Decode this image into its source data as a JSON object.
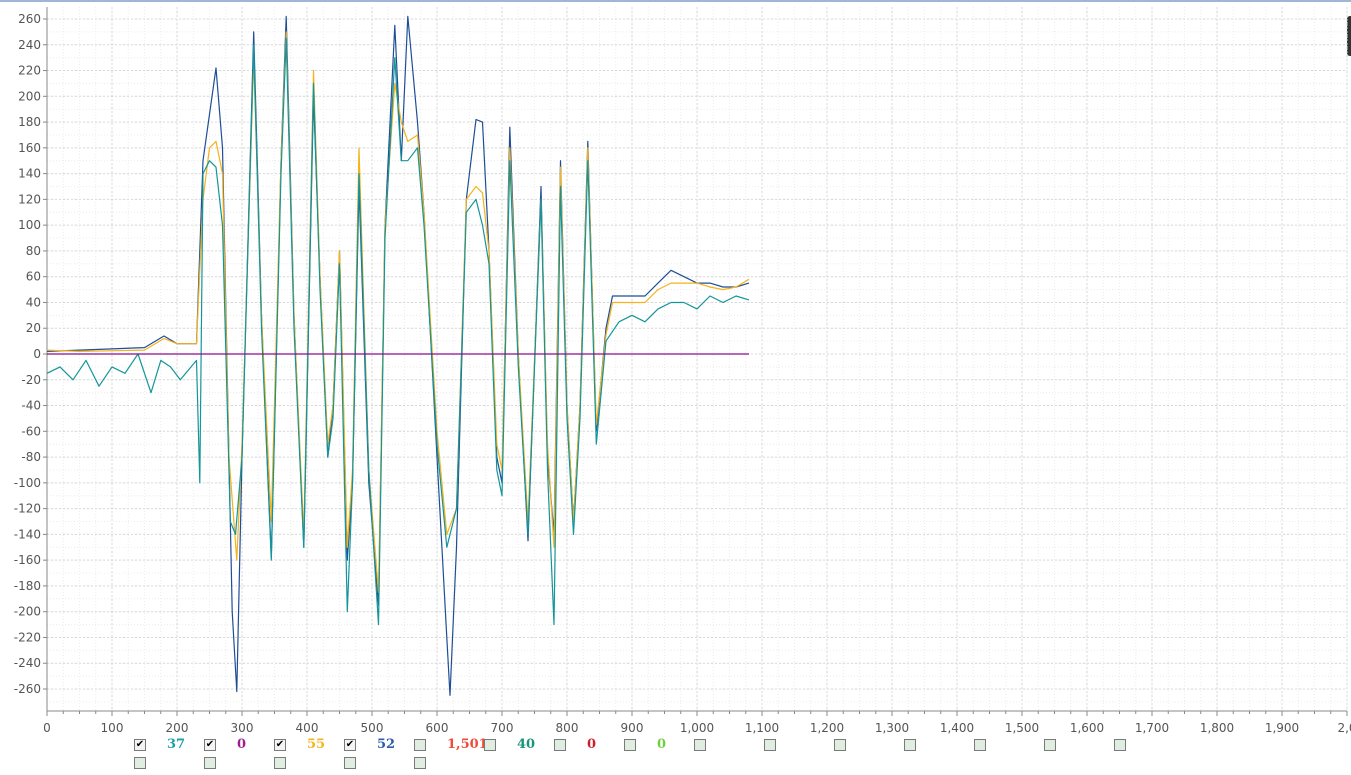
{
  "chart_data": {
    "type": "line",
    "xlim": [
      0,
      2000
    ],
    "ylim": [
      -270,
      265
    ],
    "x_ticks": [
      0,
      100,
      200,
      300,
      400,
      500,
      600,
      700,
      800,
      900,
      1000,
      1100,
      1200,
      1300,
      1400,
      1500,
      1600,
      1700,
      1800,
      1900,
      2000
    ],
    "x_tick_labels": [
      "0",
      "100",
      "200",
      "300",
      "400",
      "500",
      "600",
      "700",
      "800",
      "900",
      "1,000",
      "1,100",
      "1,200",
      "1,300",
      "1,400",
      "1,500",
      "1,600",
      "1,700",
      "1,800",
      "1,900",
      "2,0"
    ],
    "y_ticks": [
      260,
      240,
      220,
      200,
      180,
      160,
      140,
      120,
      100,
      80,
      60,
      40,
      20,
      0,
      -20,
      -40,
      -60,
      -80,
      -100,
      -120,
      -140,
      -160,
      -180,
      -200,
      -220,
      -240,
      -260
    ],
    "y_tick_labels": [
      "260",
      "240",
      "220",
      "200",
      "180",
      "160",
      "140",
      "120",
      "100",
      "80",
      "60",
      "40",
      "20",
      "0",
      "-20",
      "-40",
      "-60",
      "-80",
      "-100",
      "-120",
      "-140",
      "-160",
      "-180",
      "-200",
      "-220",
      "-240",
      "-260"
    ],
    "grid": true,
    "series": [
      {
        "color": "#1f4e96",
        "points": [
          [
            0,
            2
          ],
          [
            50,
            3
          ],
          [
            150,
            5
          ],
          [
            180,
            14
          ],
          [
            200,
            8
          ],
          [
            230,
            8
          ],
          [
            240,
            150
          ],
          [
            260,
            222
          ],
          [
            270,
            160
          ],
          [
            285,
            -200
          ],
          [
            292,
            -262
          ],
          [
            300,
            -80
          ],
          [
            318,
            250
          ],
          [
            330,
            30
          ],
          [
            345,
            -158
          ],
          [
            360,
            150
          ],
          [
            368,
            262
          ],
          [
            380,
            30
          ],
          [
            395,
            -150
          ],
          [
            410,
            200
          ],
          [
            420,
            60
          ],
          [
            432,
            -80
          ],
          [
            440,
            -40
          ],
          [
            450,
            80
          ],
          [
            462,
            -160
          ],
          [
            470,
            -100
          ],
          [
            480,
            130
          ],
          [
            495,
            -100
          ],
          [
            510,
            -195
          ],
          [
            520,
            100
          ],
          [
            535,
            255
          ],
          [
            545,
            150
          ],
          [
            555,
            262
          ],
          [
            570,
            180
          ],
          [
            580,
            110
          ],
          [
            600,
            -80
          ],
          [
            615,
            -220
          ],
          [
            620,
            -265
          ],
          [
            630,
            -150
          ],
          [
            645,
            120
          ],
          [
            660,
            182
          ],
          [
            670,
            180
          ],
          [
            680,
            80
          ],
          [
            692,
            -80
          ],
          [
            700,
            -100
          ],
          [
            712,
            176
          ],
          [
            725,
            0
          ],
          [
            740,
            -145
          ],
          [
            760,
            130
          ],
          [
            770,
            -80
          ],
          [
            780,
            -140
          ],
          [
            790,
            150
          ],
          [
            800,
            -40
          ],
          [
            810,
            -130
          ],
          [
            820,
            -40
          ],
          [
            832,
            165
          ],
          [
            845,
            -60
          ],
          [
            860,
            20
          ],
          [
            870,
            45
          ],
          [
            890,
            45
          ],
          [
            920,
            45
          ],
          [
            940,
            55
          ],
          [
            960,
            65
          ],
          [
            980,
            60
          ],
          [
            1000,
            55
          ],
          [
            1020,
            55
          ],
          [
            1040,
            52
          ],
          [
            1060,
            52
          ],
          [
            1080,
            55
          ]
        ]
      },
      {
        "color": "#f5b21a",
        "points": [
          [
            0,
            3
          ],
          [
            50,
            2
          ],
          [
            150,
            3
          ],
          [
            180,
            12
          ],
          [
            200,
            8
          ],
          [
            230,
            8
          ],
          [
            240,
            120
          ],
          [
            250,
            160
          ],
          [
            260,
            165
          ],
          [
            270,
            140
          ],
          [
            280,
            -80
          ],
          [
            292,
            -160
          ],
          [
            300,
            -70
          ],
          [
            318,
            230
          ],
          [
            330,
            30
          ],
          [
            345,
            -130
          ],
          [
            360,
            150
          ],
          [
            368,
            250
          ],
          [
            380,
            30
          ],
          [
            395,
            -140
          ],
          [
            410,
            220
          ],
          [
            420,
            60
          ],
          [
            432,
            -70
          ],
          [
            440,
            -40
          ],
          [
            450,
            80
          ],
          [
            462,
            -150
          ],
          [
            470,
            -90
          ],
          [
            480,
            160
          ],
          [
            495,
            -90
          ],
          [
            510,
            -185
          ],
          [
            520,
            100
          ],
          [
            535,
            210
          ],
          [
            545,
            180
          ],
          [
            555,
            165
          ],
          [
            570,
            170
          ],
          [
            580,
            110
          ],
          [
            600,
            -60
          ],
          [
            615,
            -140
          ],
          [
            630,
            -120
          ],
          [
            645,
            120
          ],
          [
            660,
            130
          ],
          [
            670,
            125
          ],
          [
            680,
            80
          ],
          [
            692,
            -70
          ],
          [
            700,
            -90
          ],
          [
            712,
            160
          ],
          [
            725,
            0
          ],
          [
            740,
            -130
          ],
          [
            760,
            120
          ],
          [
            770,
            -70
          ],
          [
            780,
            -150
          ],
          [
            790,
            145
          ],
          [
            800,
            -40
          ],
          [
            810,
            -130
          ],
          [
            820,
            -40
          ],
          [
            832,
            160
          ],
          [
            845,
            -55
          ],
          [
            860,
            15
          ],
          [
            870,
            40
          ],
          [
            890,
            40
          ],
          [
            920,
            40
          ],
          [
            940,
            50
          ],
          [
            960,
            55
          ],
          [
            980,
            55
          ],
          [
            1000,
            55
          ],
          [
            1020,
            52
          ],
          [
            1040,
            50
          ],
          [
            1060,
            52
          ],
          [
            1080,
            58
          ]
        ]
      },
      {
        "color": "#13959a",
        "points": [
          [
            0,
            -15
          ],
          [
            20,
            -10
          ],
          [
            40,
            -20
          ],
          [
            60,
            -5
          ],
          [
            80,
            -25
          ],
          [
            100,
            -10
          ],
          [
            120,
            -15
          ],
          [
            140,
            0
          ],
          [
            160,
            -30
          ],
          [
            175,
            -5
          ],
          [
            190,
            -10
          ],
          [
            205,
            -20
          ],
          [
            230,
            -5
          ],
          [
            235,
            -100
          ],
          [
            240,
            140
          ],
          [
            250,
            150
          ],
          [
            260,
            145
          ],
          [
            270,
            100
          ],
          [
            282,
            -130
          ],
          [
            290,
            -140
          ],
          [
            300,
            -80
          ],
          [
            318,
            240
          ],
          [
            330,
            20
          ],
          [
            345,
            -160
          ],
          [
            360,
            140
          ],
          [
            368,
            245
          ],
          [
            380,
            20
          ],
          [
            395,
            -150
          ],
          [
            410,
            210
          ],
          [
            420,
            50
          ],
          [
            432,
            -80
          ],
          [
            440,
            -50
          ],
          [
            450,
            70
          ],
          [
            462,
            -200
          ],
          [
            470,
            -100
          ],
          [
            480,
            140
          ],
          [
            495,
            -90
          ],
          [
            510,
            -210
          ],
          [
            520,
            90
          ],
          [
            535,
            230
          ],
          [
            545,
            150
          ],
          [
            555,
            150
          ],
          [
            570,
            160
          ],
          [
            580,
            100
          ],
          [
            600,
            -70
          ],
          [
            615,
            -150
          ],
          [
            630,
            -120
          ],
          [
            645,
            110
          ],
          [
            660,
            120
          ],
          [
            670,
            100
          ],
          [
            680,
            70
          ],
          [
            692,
            -90
          ],
          [
            700,
            -110
          ],
          [
            712,
            150
          ],
          [
            725,
            -10
          ],
          [
            740,
            -140
          ],
          [
            760,
            120
          ],
          [
            770,
            -90
          ],
          [
            780,
            -210
          ],
          [
            790,
            130
          ],
          [
            800,
            -50
          ],
          [
            810,
            -140
          ],
          [
            820,
            -50
          ],
          [
            832,
            150
          ],
          [
            845,
            -70
          ],
          [
            860,
            10
          ],
          [
            880,
            25
          ],
          [
            900,
            30
          ],
          [
            920,
            25
          ],
          [
            940,
            35
          ],
          [
            960,
            40
          ],
          [
            980,
            40
          ],
          [
            1000,
            35
          ],
          [
            1020,
            45
          ],
          [
            1040,
            40
          ],
          [
            1060,
            45
          ],
          [
            1080,
            42
          ]
        ]
      },
      {
        "color": "#8d0a8e",
        "points": [
          [
            0,
            0
          ],
          [
            1080,
            0
          ]
        ]
      }
    ]
  },
  "legend": {
    "values": [
      {
        "text": "37",
        "color": "#1fa0a8",
        "checked": true
      },
      {
        "text": "0",
        "color": "#9b1f8f",
        "checked": true
      },
      {
        "text": "55",
        "color": "#f2b61e",
        "checked": true
      },
      {
        "text": "52",
        "color": "#2e5ea8",
        "checked": true
      },
      {
        "text": "1,501",
        "color": "#f04a3a",
        "checked": false
      },
      {
        "text": "40",
        "color": "#17947a",
        "checked": false
      },
      {
        "text": "0",
        "color": "#d01c2c",
        "checked": false
      },
      {
        "text": "0",
        "color": "#6fcf3a",
        "checked": false
      },
      {
        "text": "",
        "color": "#000000",
        "checked": false
      },
      {
        "text": "",
        "color": "#000000",
        "checked": false
      },
      {
        "text": "",
        "color": "#000000",
        "checked": false
      },
      {
        "text": "",
        "color": "#000000",
        "checked": false
      },
      {
        "text": "",
        "color": "#000000",
        "checked": false
      },
      {
        "text": "",
        "color": "#000000",
        "checked": false
      },
      {
        "text": "",
        "color": "#000000",
        "checked": false
      }
    ],
    "second_row_count": 5
  }
}
